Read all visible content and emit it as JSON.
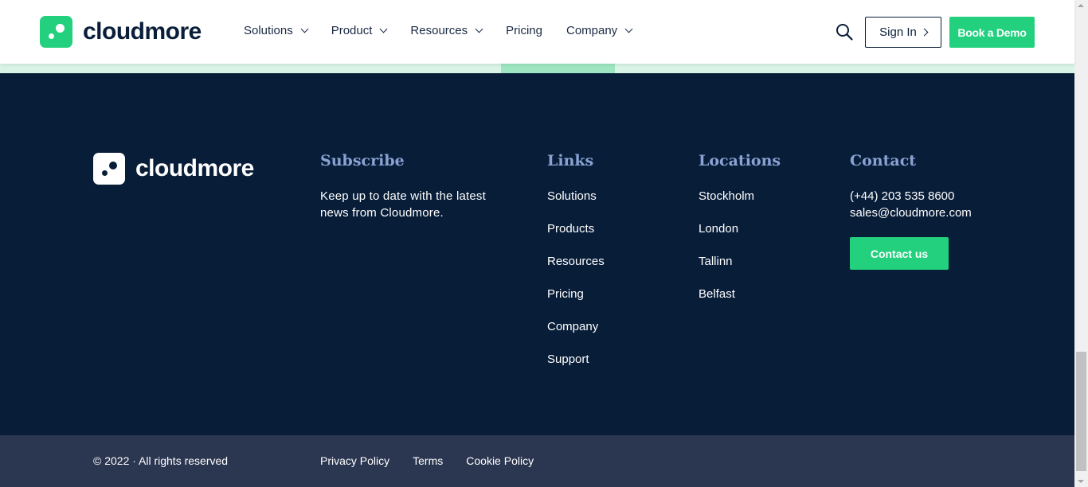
{
  "header": {
    "logo_text": "cloudmore",
    "nav": [
      {
        "label": "Solutions",
        "has_dropdown": true
      },
      {
        "label": "Product",
        "has_dropdown": true
      },
      {
        "label": "Resources",
        "has_dropdown": true
      },
      {
        "label": "Pricing",
        "has_dropdown": false
      },
      {
        "label": "Company",
        "has_dropdown": true
      }
    ],
    "search_icon": "search-icon",
    "signin_label": "Sign In",
    "demo_label": "Book a Demo"
  },
  "footer": {
    "logo_text": "cloudmore",
    "subscribe": {
      "heading": "Subscribe",
      "text": "Keep up to date with the latest news from Cloudmore."
    },
    "links": {
      "heading": "Links",
      "items": [
        "Solutions",
        "Products",
        "Resources",
        "Pricing",
        "Company",
        "Support"
      ]
    },
    "locations": {
      "heading": "Locations",
      "items": [
        "Stockholm",
        "London",
        "Tallinn",
        "Belfast"
      ]
    },
    "contact": {
      "heading": "Contact",
      "phone": "(+44) 203 535 8600",
      "email": "sales@cloudmore.com",
      "button_label": "Contact us"
    }
  },
  "bottom": {
    "copyright": "© 2022 · All rights reserved",
    "legal": [
      "Privacy Policy",
      "Terms",
      "Cookie Policy"
    ]
  },
  "colors": {
    "brand_green": "#22d07d",
    "navy": "#081d38",
    "heading_blue": "#8aa3d4",
    "bottom_bar": "#2b3650"
  }
}
